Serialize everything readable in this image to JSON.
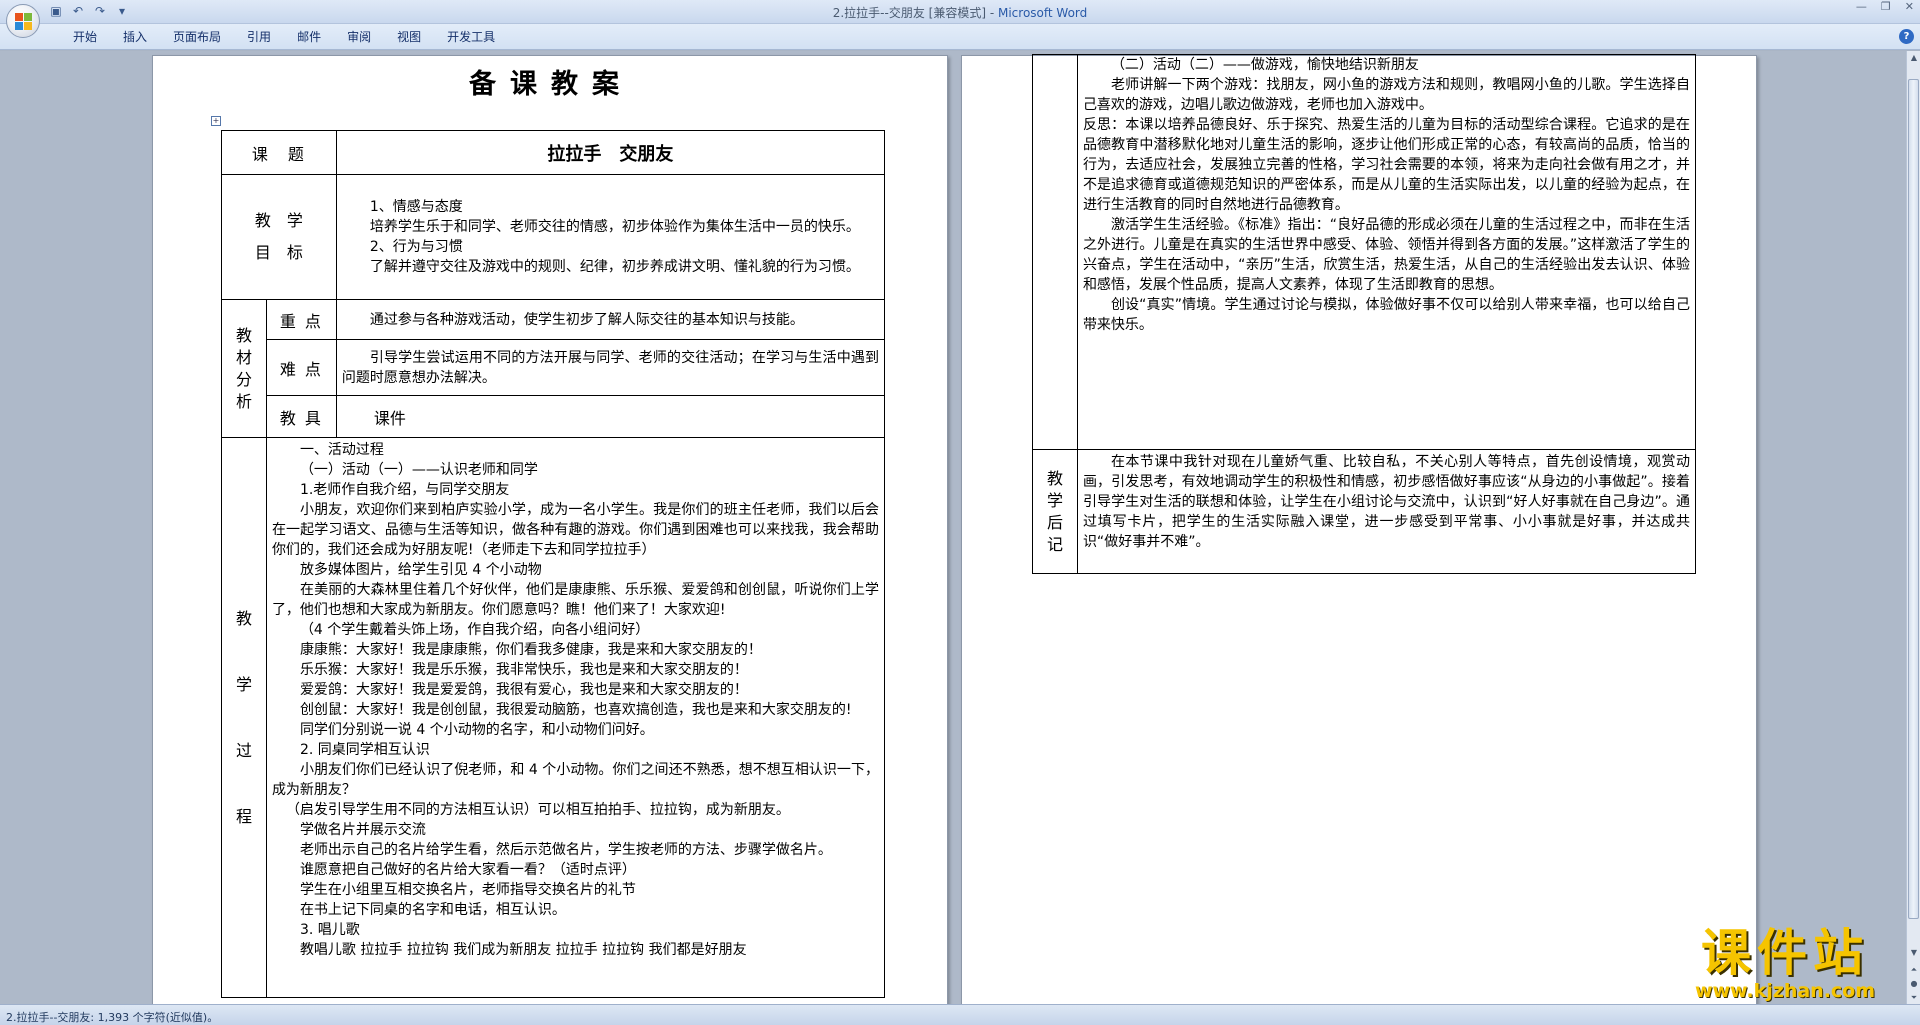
{
  "window": {
    "title_doc": "2.拉拉手--交朋友 [兼容模式] - ",
    "title_app": "Microsoft Word"
  },
  "ribbon": {
    "tabs": [
      "开始",
      "插入",
      "页面布局",
      "引用",
      "邮件",
      "审阅",
      "视图",
      "开发工具"
    ]
  },
  "doc": {
    "title": "备课教案",
    "topic_label": "课　题",
    "topic_value": "拉拉手　交朋友",
    "goal_label_1": "教　学",
    "goal_label_2": "目　标",
    "goal_lines": [
      "1、情感与态度",
      "培养学生乐于和同学、老师交往的情感，初步体验作为集体生活中一员的快乐。",
      "2、行为与习惯",
      "了解并遵守交往及游戏中的规则、纪律，初步养成讲文明、懂礼貌的行为习惯。"
    ],
    "analysis_label": [
      "教",
      "材",
      "分",
      "析"
    ],
    "key_label": "重 点",
    "key_value": "通过参与各种游戏活动，使学生初步了解人际交往的基本知识与技能。",
    "diff_label": "难 点",
    "diff_value": "引导学生尝试运用不同的方法开展与同学、老师的交往活动；在学习与生活中遇到问题时愿意想办法解决。",
    "tool_label": "教 具",
    "tool_value": "课件",
    "process_label": [
      "教",
      "学",
      "过",
      "程"
    ],
    "process_lines": [
      "一、活动过程",
      "（一）活动（一）——认识老师和同学",
      "1.老师作自我介绍，与同学交朋友",
      "小朋友，欢迎你们来到柏庐实验小学，成为一名小学生。我是你们的班主任老师，我们以后会在一起学习语文、品德与生活等知识，做各种有趣的游戏。你们遇到困难也可以来找我，我会帮助你们的，我们还会成为好朋友呢!（老师走下去和同学拉拉手）",
      "放多媒体图片，给学生引见 4 个小动物",
      "在美丽的大森林里住着几个好伙伴，他们是康康熊、乐乐猴、爱爱鸽和创创鼠，听说你们上学了，他们也想和大家成为新朋友。你们愿意吗？瞧！他们来了！大家欢迎!",
      "（4 个学生戴着头饰上场，作自我介绍，向各小组问好）",
      "康康熊：大家好！我是康康熊，你们看我多健康，我是来和大家交朋友的！",
      "乐乐猴：大家好！我是乐乐猴，我非常快乐，我也是来和大家交朋友的！",
      "爱爱鸽：大家好！我是爱爱鸽，我很有爱心，我也是来和大家交朋友的！",
      "创创鼠：大家好！我是创创鼠，我很爱动脑筋，也喜欢搞创造，我也是来和大家交朋友的!",
      "同学们分别说一说 4 个小动物的名字，和小动物们问好。",
      "2. 同桌同学相互认识",
      "小朋友们你们已经认识了倪老师，和 4 个小动物。你们之间还不熟悉，想不想互相认识一下，成为新朋友？",
      "（启发引导学生用不同的方法相互认识）可以相互拍拍手、拉拉钩，成为新朋友。",
      "学做名片并展示交流",
      "老师出示自己的名片给学生看，然后示范做名片，学生按老师的方法、步骤学做名片。",
      "谁愿意把自己做好的名片给大家看一看？（适时点评）",
      "学生在小组里互相交换名片，老师指导交换名片的礼节",
      "在书上记下同桌的名字和电话，相互认识。",
      "3. 唱儿歌",
      "教唱儿歌  拉拉手  拉拉钩  我们成为新朋友  拉拉手  拉拉钩  我们都是好朋友"
    ],
    "p2_lines": [
      "（二）活动（二）——做游戏，愉快地结识新朋友",
      "老师讲解一下两个游戏：找朋友，网小鱼的游戏方法和规则，教唱网小鱼的儿歌。学生选择自己喜欢的游戏，边唱儿歌边做游戏，老师也加入游戏中。",
      "反思：本课以培养品德良好、乐于探究、热爱生活的儿童为目标的活动型综合课程。它追求的是在品德教育中潜移默化地对儿童生活的影响，逐步让他们形成正常的心态，有较高尚的品质，恰当的行为，去适应社会，发展独立完善的性格，学习社会需要的本领，将来为走向社会做有用之才，并不是追求德育或道德规范知识的严密体系，而是从儿童的生活实际出发，以儿童的经验为起点，在进行生活教育的同时自然地进行品德教育。",
      "激活学生生活经验。《标准》指出：“良好品德的形成必须在儿童的生活过程之中，而非在生活之外进行。儿童是在真实的生活世界中感受、体验、领悟并得到各方面的发展。”这样激活了学生的兴奋点，学生在活动中，“亲历”生活，欣赏生活，热爱生活，从自己的生活经验出发去认识、体验和感悟，发展个性品质，提高人文素养，体现了生活即教育的思想。",
      "创设“真实”情境。学生通过讨论与模拟，体验做好事不仅可以给别人带来幸福，也可以给自己带来快乐。"
    ],
    "post_label": [
      "教",
      "学",
      "后",
      "记"
    ],
    "post_value": "在本节课中我针对现在儿童娇气重、比较自私，不关心别人等特点，首先创设情境，观赏动画，引发思考，有效地调动学生的积极性和情感，初步感悟做好事应该“从身边的小事做起”。接着引导学生对生活的联想和体验，让学生在小组讨论与交流中，认识到“好人好事就在自己身边”。通过填写卡片，把学生的生活实际融入课堂，进一步感受到平常事、小小事就是好事，并达成共识“做好事并不难”。"
  },
  "statusbar": {
    "text": "2.拉拉手--交朋友: 1,393 个字符(近似值)。"
  },
  "watermark": {
    "title": "课件站",
    "url": "www.kjzhan.com"
  }
}
